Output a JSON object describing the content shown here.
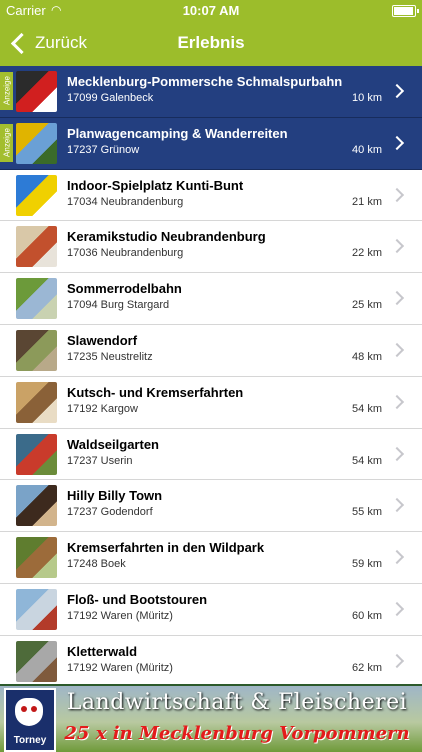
{
  "status": {
    "carrier": "Carrier",
    "time": "10:07 AM"
  },
  "nav": {
    "back_label": "Zurück",
    "title": "Erlebnis"
  },
  "ad_label": "Anzeige",
  "items": [
    {
      "title": "Mecklenburg-Pommersche Schmalspurbahn",
      "subtitle": "17099 Galenbeck",
      "distance": "10 km",
      "ad": true,
      "colors": [
        "#2b2b2b",
        "#d11f1f",
        "#ffffff"
      ]
    },
    {
      "title": "Planwagencamping & Wanderreiten",
      "subtitle": "17237 Grünow",
      "distance": "40 km",
      "ad": true,
      "colors": [
        "#e0b400",
        "#6aa0d6",
        "#3a6b2a"
      ]
    },
    {
      "title": "Indoor-Spielplatz Kunti-Bunt",
      "subtitle": "17034 Neubrandenburg",
      "distance": "21 km",
      "ad": false,
      "colors": [
        "#2d7bd6",
        "#f0d000",
        "#ffffff"
      ]
    },
    {
      "title": "Keramikstudio Neubrandenburg",
      "subtitle": "17036 Neubrandenburg",
      "distance": "22 km",
      "ad": false,
      "colors": [
        "#d9c8a8",
        "#c2502d",
        "#e8e3da"
      ]
    },
    {
      "title": "Sommerrodelbahn",
      "subtitle": "17094 Burg Stargard",
      "distance": "25 km",
      "ad": false,
      "colors": [
        "#6c9a3a",
        "#9bb7d4",
        "#c9d2b1"
      ]
    },
    {
      "title": "Slawendorf",
      "subtitle": "17235 Neustrelitz",
      "distance": "48 km",
      "ad": false,
      "colors": [
        "#5a4633",
        "#8c9a5a",
        "#b8a989"
      ]
    },
    {
      "title": "Kutsch- und Kremserfahrten",
      "subtitle": "17192 Kargow",
      "distance": "54 km",
      "ad": false,
      "colors": [
        "#caa266",
        "#8a6138",
        "#e9dcc4"
      ]
    },
    {
      "title": "Waldseilgarten",
      "subtitle": "17237 Userin",
      "distance": "54 km",
      "ad": false,
      "colors": [
        "#3b6b8a",
        "#c93b2b",
        "#6b8c3a"
      ]
    },
    {
      "title": "Hilly Billy Town",
      "subtitle": "17237 Godendorf",
      "distance": "55 km",
      "ad": false,
      "colors": [
        "#7aa3c8",
        "#3d2a1e",
        "#d2b48c"
      ]
    },
    {
      "title": "Kremserfahrten in den Wildpark",
      "subtitle": "17248 Boek",
      "distance": "59 km",
      "ad": false,
      "colors": [
        "#5f7d2f",
        "#9c6b3a",
        "#b6c98a"
      ]
    },
    {
      "title": "Floß- und Bootstouren",
      "subtitle": "17192 Waren (Müritz)",
      "distance": "60 km",
      "ad": false,
      "colors": [
        "#8fb6d8",
        "#c9d5e0",
        "#b33b2a"
      ]
    },
    {
      "title": "Kletterwald",
      "subtitle": "17192 Waren (Müritz)",
      "distance": "62 km",
      "ad": false,
      "colors": [
        "#4e6b3a",
        "#a8a8a8",
        "#7f5a3c"
      ]
    }
  ],
  "banner": {
    "line1": "Landwirtschaft & Fleischerei",
    "line2": "25 x in Mecklenburg Vorpommern",
    "brand": "Torney"
  }
}
